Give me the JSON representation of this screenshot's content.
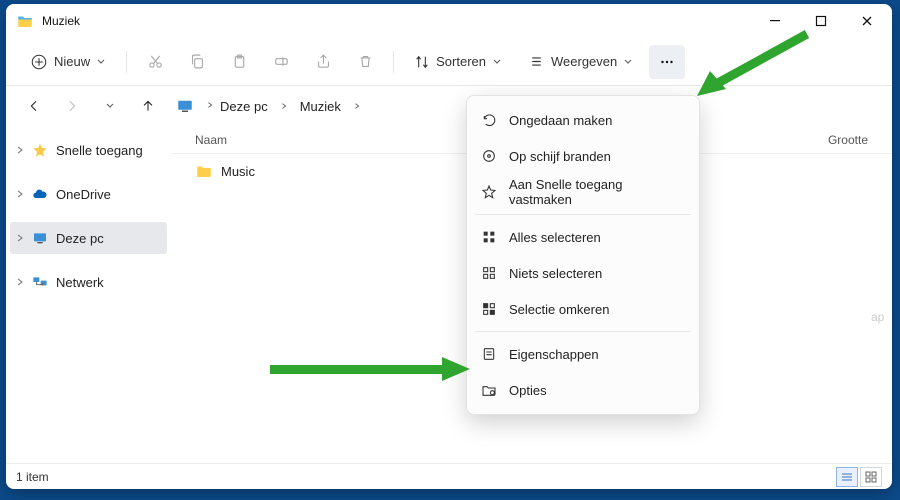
{
  "window": {
    "title": "Muziek"
  },
  "toolbar": {
    "new_label": "Nieuw",
    "sort_label": "Sorteren",
    "view_label": "Weergeven"
  },
  "breadcrumb": {
    "root": "Deze pc",
    "folder": "Muziek"
  },
  "sidebar": {
    "items": [
      {
        "label": "Snelle toegang",
        "icon": "star"
      },
      {
        "label": "OneDrive",
        "icon": "cloud"
      },
      {
        "label": "Deze pc",
        "icon": "monitor",
        "selected": true
      },
      {
        "label": "Netwerk",
        "icon": "network"
      }
    ]
  },
  "columns": {
    "name": "Naam",
    "size": "Grootte"
  },
  "items": [
    {
      "name": "Music",
      "type": "folder"
    }
  ],
  "truncated_text": "ap",
  "menu": {
    "items": [
      {
        "label": "Ongedaan maken",
        "icon": "undo"
      },
      {
        "label": "Op schijf branden",
        "icon": "disc"
      },
      {
        "label": "Aan Snelle toegang vastmaken",
        "icon": "star"
      },
      {
        "label": "Alles selecteren",
        "icon": "select-all"
      },
      {
        "label": "Niets selecteren",
        "icon": "select-none"
      },
      {
        "label": "Selectie omkeren",
        "icon": "select-invert"
      },
      {
        "label": "Eigenschappen",
        "icon": "properties"
      },
      {
        "label": "Opties",
        "icon": "options"
      }
    ]
  },
  "status": {
    "count": "1 item"
  }
}
